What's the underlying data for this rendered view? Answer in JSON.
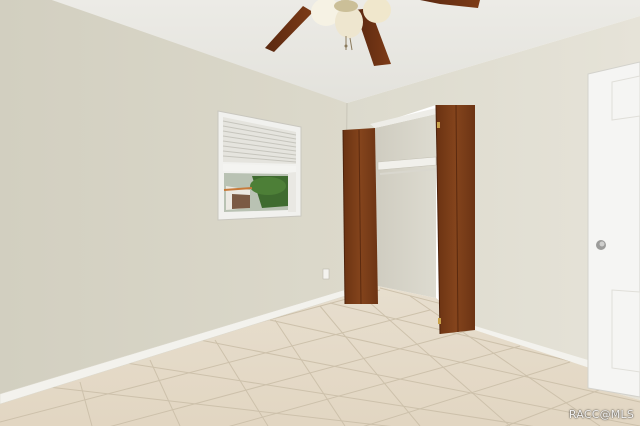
{
  "watermark": {
    "text": "RACC@MLS"
  },
  "colors": {
    "left_wall": "#d6d3c5",
    "back_wall": "#e0ddd1",
    "ceiling": "#e9e8e2",
    "floor_tile": "#e4d9c6",
    "grout": "#cbbfa9",
    "wood_door": "#7a3d18",
    "entry_door": "#f4f4f2",
    "baseboard": "#f2f1ec"
  },
  "icons": {
    "ceiling_fan": "ceiling-fan-icon",
    "door_knob": "door-knob-icon"
  }
}
